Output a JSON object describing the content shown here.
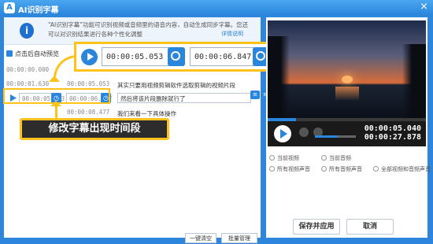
{
  "window": {
    "title": "AI识别字幕",
    "logo": "A",
    "close": "×"
  },
  "info": {
    "icon": "i",
    "text": "“AI识别字幕”功能可识别视频或音频里的语音内容，自动生成同步字幕。您还可以对识别结果进行各种个性化调整",
    "more": "详情说明"
  },
  "autoplay": {
    "label": "点击后自动预览",
    "checked": true
  },
  "zoom": {
    "start": "00:00:05.053",
    "end": "00:00:06.847"
  },
  "callout": "修改字幕出现时间段",
  "subtitles": [
    {
      "start": "00:00:00.000",
      "end": "",
      "text": ""
    },
    {
      "start": "00:00:01.630",
      "end": "00:00:05.053",
      "text": "其实只要用视频剪辑软件选取剪辑的视频片段"
    },
    {
      "start": "00:00:05.053",
      "end": "00:00:06.847",
      "text": "然后将该片段删除就行了"
    },
    {
      "start": "00:00:06.847",
      "end": "00:00:08.477",
      "text": "我们来看一下具体操作"
    }
  ],
  "bottom": {
    "clear": "一键清空",
    "batch": "批量管理"
  },
  "player": {
    "current": "00:00:05.040",
    "total": "00:00:27.878",
    "progress": 0.18,
    "volume": 0.55
  },
  "options": [
    "当前视频",
    "当前音频",
    "所有视频声音",
    "所有音频声音",
    "全部视频和音频声音"
  ],
  "actions": {
    "save": "保存并应用",
    "cancel": "取消"
  },
  "colors": {
    "accent": "#2a85dc",
    "highlight": "#ffc21a"
  }
}
